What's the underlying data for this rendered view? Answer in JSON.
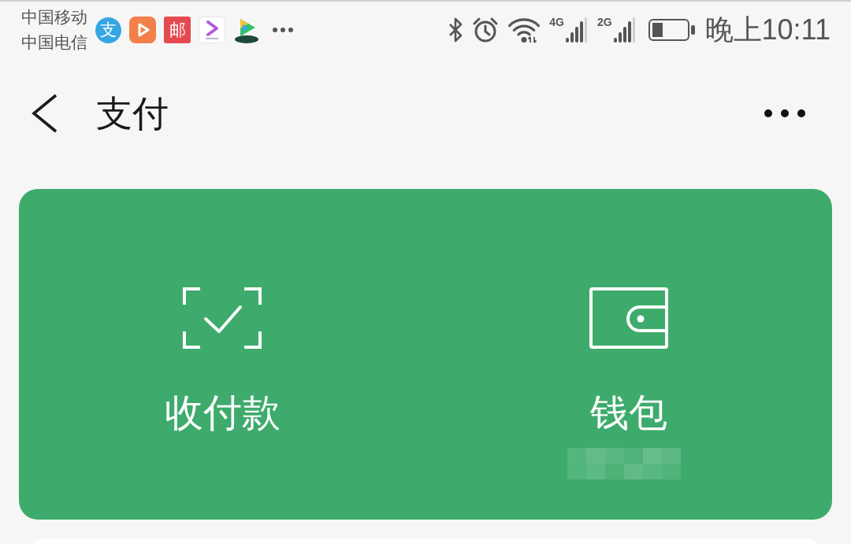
{
  "status_bar": {
    "carriers": [
      "中国移动",
      "中国电信"
    ],
    "app_icons": [
      {
        "kind": "disc",
        "glyph": "支"
      },
      {
        "kind": "play"
      },
      {
        "kind": "tile",
        "glyph": "邮"
      },
      {
        "kind": "chevron"
      },
      {
        "kind": "video"
      }
    ],
    "networks": [
      "4G",
      "2G"
    ],
    "time": "晚上10:11"
  },
  "nav_bar": {
    "title": "支付"
  },
  "pay_card": {
    "actions": [
      {
        "kind": "scan",
        "label": "收付款",
        "masked": false
      },
      {
        "kind": "wallet",
        "label": "钱包",
        "masked": true
      }
    ]
  }
}
